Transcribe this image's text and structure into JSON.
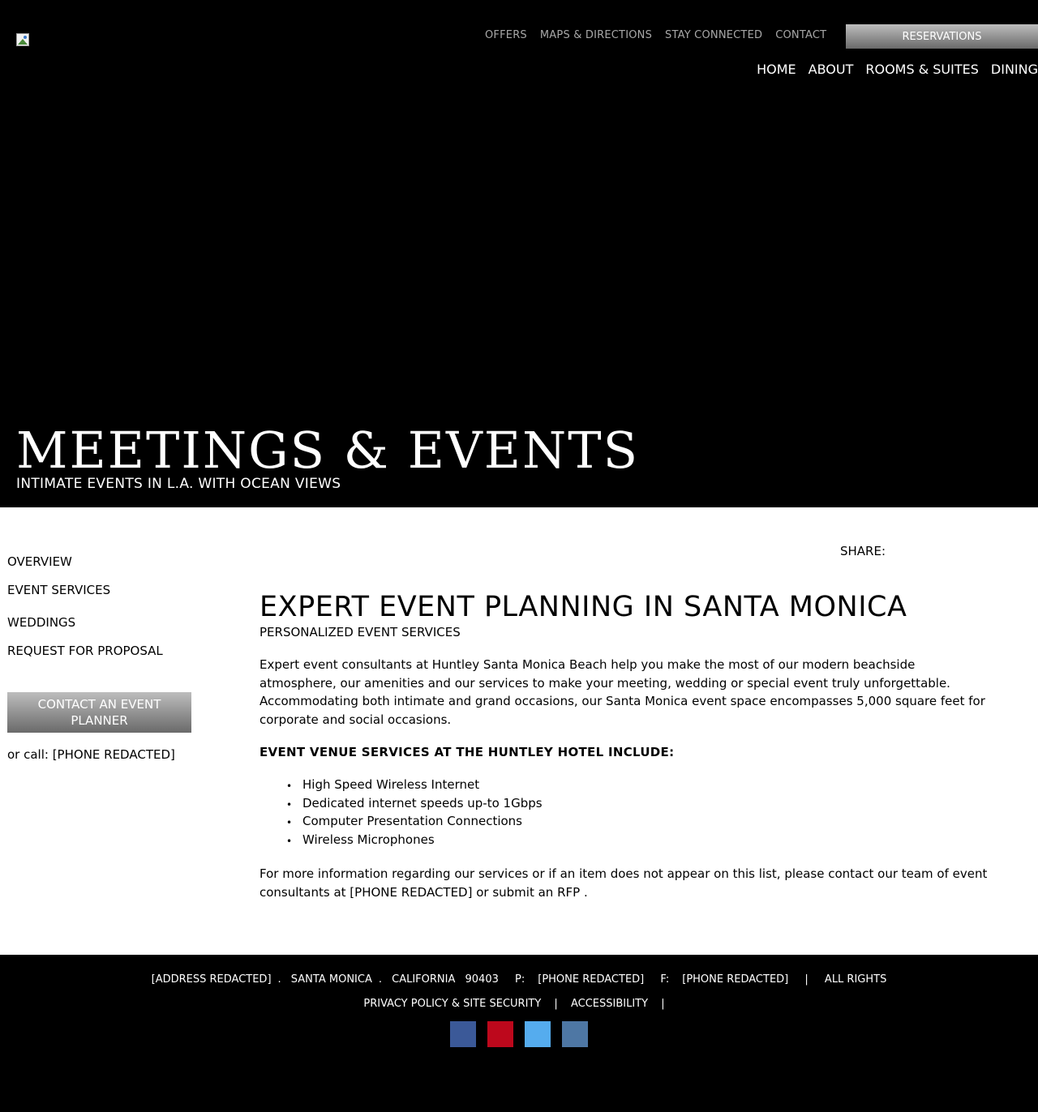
{
  "colors": {
    "hero_bg": "#000000",
    "footer_bg": "#000000",
    "button_gradient_top": "#bdbdbd",
    "button_gradient_bottom": "#6a6a6a",
    "util_nav_text": "#a8a8a8",
    "facebook": "#3b5998",
    "pinterest": "#bd081c",
    "twitter": "#55acee",
    "linkedin": "#4e77a4"
  },
  "header": {
    "logo_icon": "broken-image-icon",
    "util_nav": [
      "OFFERS",
      "MAPS & DIRECTIONS",
      "STAY CONNECTED",
      "CONTACT"
    ],
    "reservations_label": "RESERVATIONS",
    "main_nav": [
      "HOME",
      "ABOUT",
      "ROOMS & SUITES",
      "DINING"
    ]
  },
  "hero": {
    "title": "MEETINGS & EVENTS",
    "subtitle": "INTIMATE EVENTS IN L.A. WITH OCEAN VIEWS"
  },
  "sidebar": {
    "links": [
      "OVERVIEW",
      "EVENT SERVICES",
      "WEDDINGS",
      "REQUEST FOR PROPOSAL"
    ],
    "contact_button_line1": "CONTACT AN EVENT",
    "contact_button_line2": "PLANNER",
    "call_text": "or call: [PHONE REDACTED]"
  },
  "share_label": "SHARE:",
  "content": {
    "heading": "EXPERT EVENT PLANNING IN SANTA MONICA",
    "subheading": "PERSONALIZED EVENT SERVICES",
    "intro": "Expert event consultants at Huntley Santa Monica Beach help you make the most of our modern beachside atmosphere, our amenities and our services to make your meeting, wedding or special event truly unforgettable. Accommodating both intimate and grand occasions, our Santa Monica event space encompasses 5,000 square feet for corporate and social occasions.",
    "services_heading": "EVENT VENUE SERVICES AT THE HUNTLEY HOTEL INCLUDE:",
    "services": [
      "High Speed Wireless Internet",
      "Dedicated internet speeds up-to 1Gbps",
      "Computer Presentation Connections",
      "Wireless Microphones"
    ],
    "more_info_text": "For more information regarding our services or if an item does not appear on this list, please contact our team of event consultants at [PHONE REDACTED] or ",
    "more_info_link": " submit an RFP",
    "more_info_end": " ."
  },
  "footer": {
    "address": "[ADDRESS REDACTED]",
    "city": "SANTA MONICA",
    "state": "CALIFORNIA",
    "zip": "90403",
    "phone_label": "P:",
    "phone": "[PHONE REDACTED]",
    "fax_label": "F:",
    "fax": "[PHONE REDACTED]",
    "separator": "|",
    "dot": ".",
    "rights": "ALL RIGHTS",
    "privacy": "PRIVACY POLICY & SITE SECURITY",
    "accessibility": "ACCESSIBILITY",
    "social_icons": [
      "facebook-icon",
      "pinterest-icon",
      "twitter-icon",
      "linkedin-icon"
    ]
  }
}
